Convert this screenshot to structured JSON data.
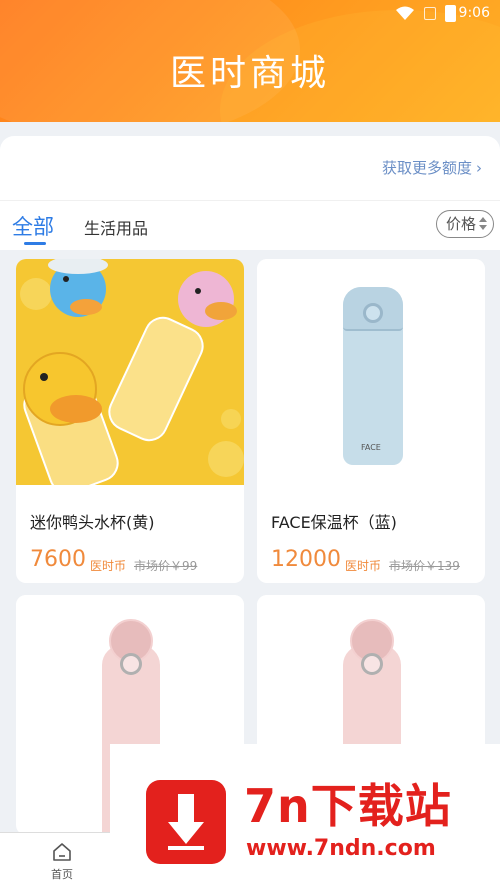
{
  "status_bar": {
    "time": "9:06"
  },
  "header": {
    "title": "医时商城"
  },
  "quota": {
    "link_text": "获取更多额度"
  },
  "tabs": [
    {
      "label": "全部",
      "active": true
    },
    {
      "label": "生活用品",
      "active": false
    }
  ],
  "sort": {
    "label": "价格"
  },
  "products": [
    {
      "name": "迷你鸭头水杯(黄)",
      "price": "7600",
      "currency": "医时币",
      "market_price": "市场价￥99"
    },
    {
      "name": "FACE保温杯（蓝)",
      "price": "12000",
      "currency": "医时币",
      "market_price": "市场价￥139"
    }
  ],
  "bottom_nav": {
    "home_label": "首页"
  },
  "watermark": {
    "brand": "7n下载站",
    "url": "www.7ndn.com"
  },
  "colors": {
    "accent": "#2e7ce5",
    "price": "#f08a3c",
    "header_start": "#ff7a1a",
    "header_end": "#ffb126"
  }
}
